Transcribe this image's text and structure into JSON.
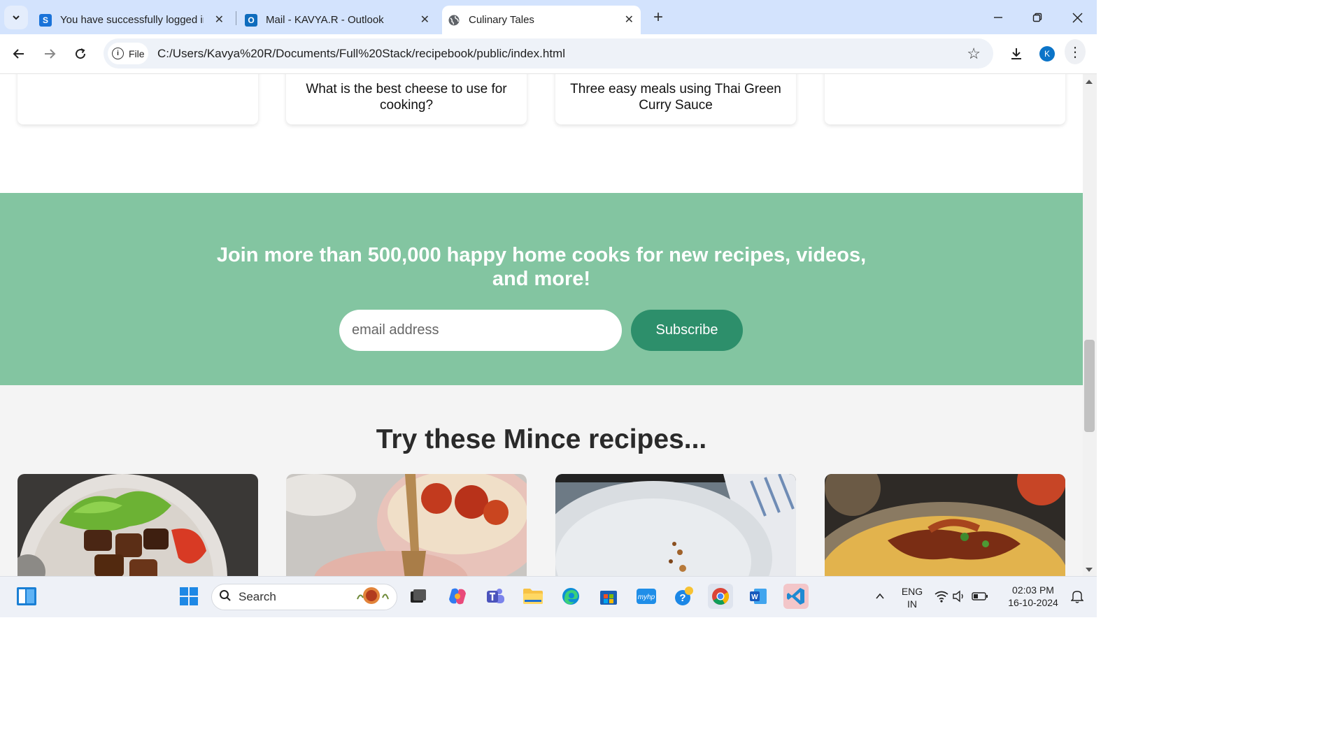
{
  "browser": {
    "tabs": [
      {
        "title": "You have successfully logged in",
        "favicon": "S",
        "favicon_color": "#1a73d9",
        "active": false
      },
      {
        "title": "Mail - KAVYA.R - Outlook",
        "favicon": "O",
        "favicon_color": "#0f6cbd",
        "active": false
      },
      {
        "title": "Culinary Tales",
        "favicon": "globe-icon",
        "active": true
      }
    ],
    "address": {
      "chip_label": "File",
      "url": "C:/Users/Kavya%20R/Documents/Full%20Stack/recipebook/public/index.html"
    },
    "profile_initial": "K"
  },
  "page": {
    "top_cards": [
      {
        "title": ""
      },
      {
        "title": "What is the best cheese to use for cooking?"
      },
      {
        "title": "Three easy meals using Thai Green Curry Sauce"
      },
      {
        "title": ""
      }
    ],
    "subscribe": {
      "heading": "Join more than 500,000 happy home cooks for new recipes, videos, and more!",
      "email_placeholder": "email address",
      "button_label": "Subscribe",
      "band_color": "#83c5a1",
      "button_color": "#2d8f6b"
    },
    "mince_section": {
      "heading": "Try these Mince recipes...",
      "recipe_images": [
        "steak-salad-image",
        "meatball-pasta-image",
        "plate-image",
        "chicken-noodles-image"
      ]
    }
  },
  "taskbar": {
    "search_placeholder": "Search",
    "language": "ENG",
    "region": "IN",
    "time": "02:03 PM",
    "date": "16-10-2024"
  }
}
